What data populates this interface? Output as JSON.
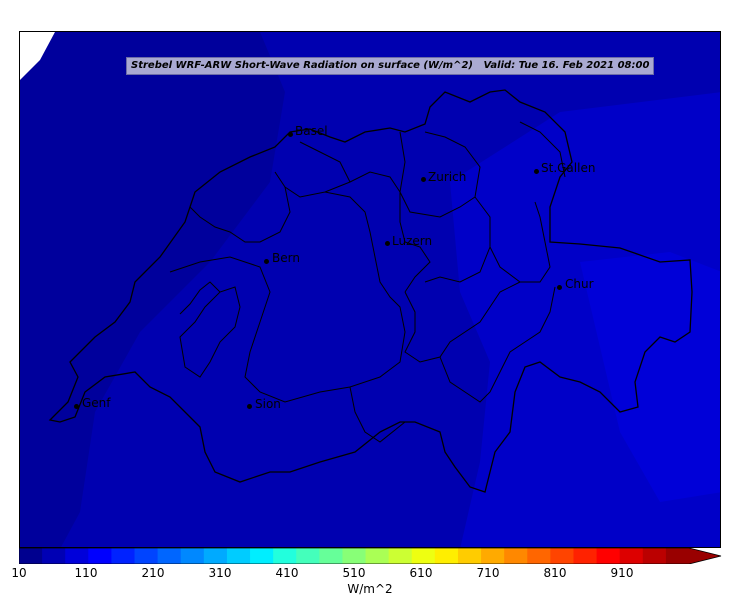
{
  "title": {
    "left": "Strebel WRF-ARW Short-Wave Radiation on surface (W/m^2)",
    "right": "Valid: Tue 16. Feb 2021 08:00"
  },
  "cities": [
    {
      "name": "Basel"
    },
    {
      "name": "Zurich"
    },
    {
      "name": "St.Gallen"
    },
    {
      "name": "Bern"
    },
    {
      "name": "Luzern"
    },
    {
      "name": "Chur"
    },
    {
      "name": "Genf"
    },
    {
      "name": "Sion"
    }
  ],
  "colorbar": {
    "unit": "W/m^2",
    "ticks": [
      "10",
      "110",
      "210",
      "310",
      "410",
      "510",
      "610",
      "710",
      "810",
      "910"
    ],
    "min": 10,
    "max": 1010,
    "colors": [
      "#00008f",
      "#0000b4",
      "#0000da",
      "#0000ff",
      "#0022ff",
      "#0044ff",
      "#0066ff",
      "#0088ff",
      "#00aaff",
      "#00ccff",
      "#00eeff",
      "#22ffdd",
      "#44ffbb",
      "#66ff99",
      "#88ff77",
      "#aaff55",
      "#ccff33",
      "#eeff11",
      "#ffee00",
      "#ffcc00",
      "#ffaa00",
      "#ff8800",
      "#ff6600",
      "#ff4400",
      "#ff2200",
      "#ff0000",
      "#dd0000",
      "#bb0000",
      "#990000"
    ]
  },
  "colors": {
    "field_dark": "#0000a0",
    "field_mid": "#0000bb",
    "field_light": "#0000cc",
    "field_east": "#0000dd",
    "border": "#000000"
  }
}
